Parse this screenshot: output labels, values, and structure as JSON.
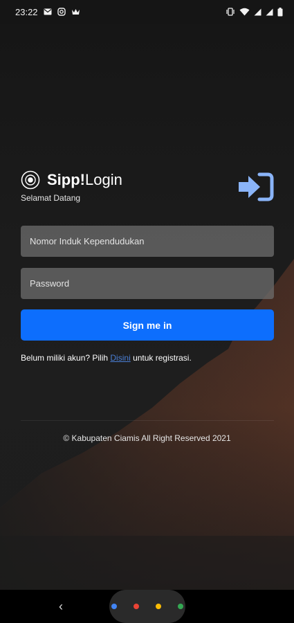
{
  "status_bar": {
    "time": "23:22",
    "icons_left": [
      "mail-icon",
      "instagram-icon",
      "crown-icon"
    ],
    "icons_right": [
      "vibrate-icon",
      "wifi-icon",
      "signal-icon",
      "signal-icon",
      "battery-icon"
    ]
  },
  "header": {
    "brand_bold": "Sipp!",
    "brand_light": "Login",
    "subtitle": "Selamat Datang",
    "accent_color": "#8ab4f8"
  },
  "form": {
    "nik_placeholder": "Nomor Induk Kependudukan",
    "password_placeholder": "Password",
    "signin_label": "Sign me in",
    "button_color": "#0d6efd"
  },
  "register": {
    "prefix": "Belum miliki akun? Pilih ",
    "link_label": "Disini",
    "suffix": " untuk registrasi."
  },
  "footer": {
    "text": "© Kabupaten Ciamis All Right Reserved 2021"
  },
  "nav_bar": {
    "back_glyph": "‹",
    "assistant_dots": [
      "#4285f4",
      "#ea4335",
      "#fbbc05",
      "#34a853"
    ]
  }
}
